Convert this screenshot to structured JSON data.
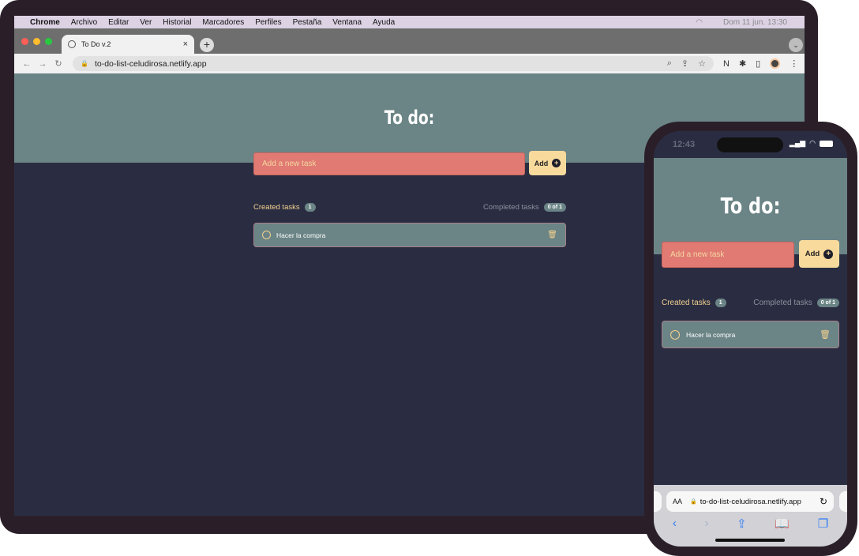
{
  "mac_menubar": {
    "app": "Chrome",
    "items": [
      "Archivo",
      "Editar",
      "Ver",
      "Historial",
      "Marcadores",
      "Perfiles",
      "Pestaña",
      "Ventana",
      "Ayuda"
    ],
    "clock": "Dom 11 jun. 13:30"
  },
  "browser": {
    "tab_title": "To Do v.2",
    "url": "to-do-list-celudirosa.netlify.app"
  },
  "app": {
    "title": "To do:",
    "input_placeholder": "Add a new task",
    "add_label": "Add",
    "created_label": "Created tasks",
    "created_count": "1",
    "completed_label": "Completed tasks",
    "completed_count": "0 of 1",
    "tasks": [
      {
        "text": "Hacer la compra",
        "done": false
      }
    ]
  },
  "phone": {
    "time": "12:43",
    "aa_label": "AA",
    "url": "to-do-list-celudirosa.netlify.app"
  },
  "colors": {
    "header": "#6b8486",
    "background": "#2a2d42",
    "input": "#e07a73",
    "button": "#f8da9c",
    "accent": "#f3d18f"
  }
}
